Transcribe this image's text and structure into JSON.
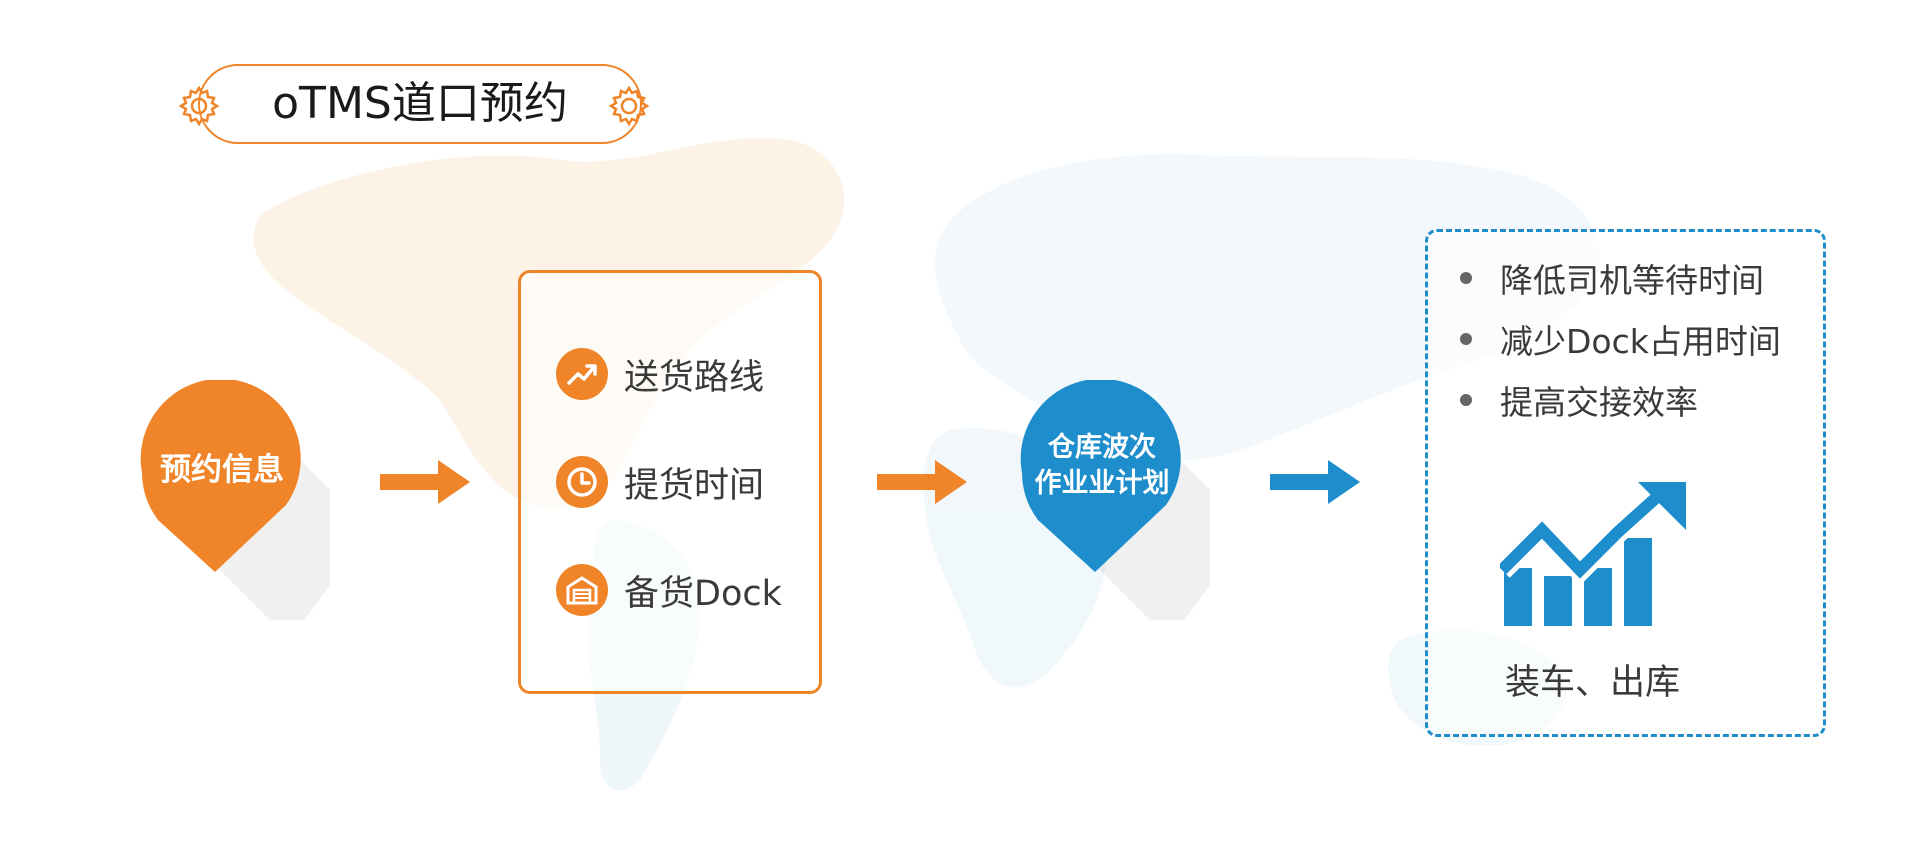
{
  "title": "oTMS道口预约",
  "steps": {
    "start": "预约信息",
    "middle_items": [
      "送货路线",
      "提货时间",
      "备货Dock"
    ],
    "warehouse": [
      "仓库波次",
      "作业业计划"
    ],
    "benefits": [
      "降低司机等待时间",
      "减少Dock占用时间",
      "提高交接效率"
    ],
    "final": "装车、出库"
  },
  "colors": {
    "orange": "#F08428",
    "blue": "#1D8DCC",
    "text": "#3a3a3a"
  },
  "icons": [
    "gear-icon",
    "trend-up-icon",
    "clock-icon",
    "warehouse-icon",
    "arrow-right-icon",
    "bar-chart-growth-icon"
  ]
}
